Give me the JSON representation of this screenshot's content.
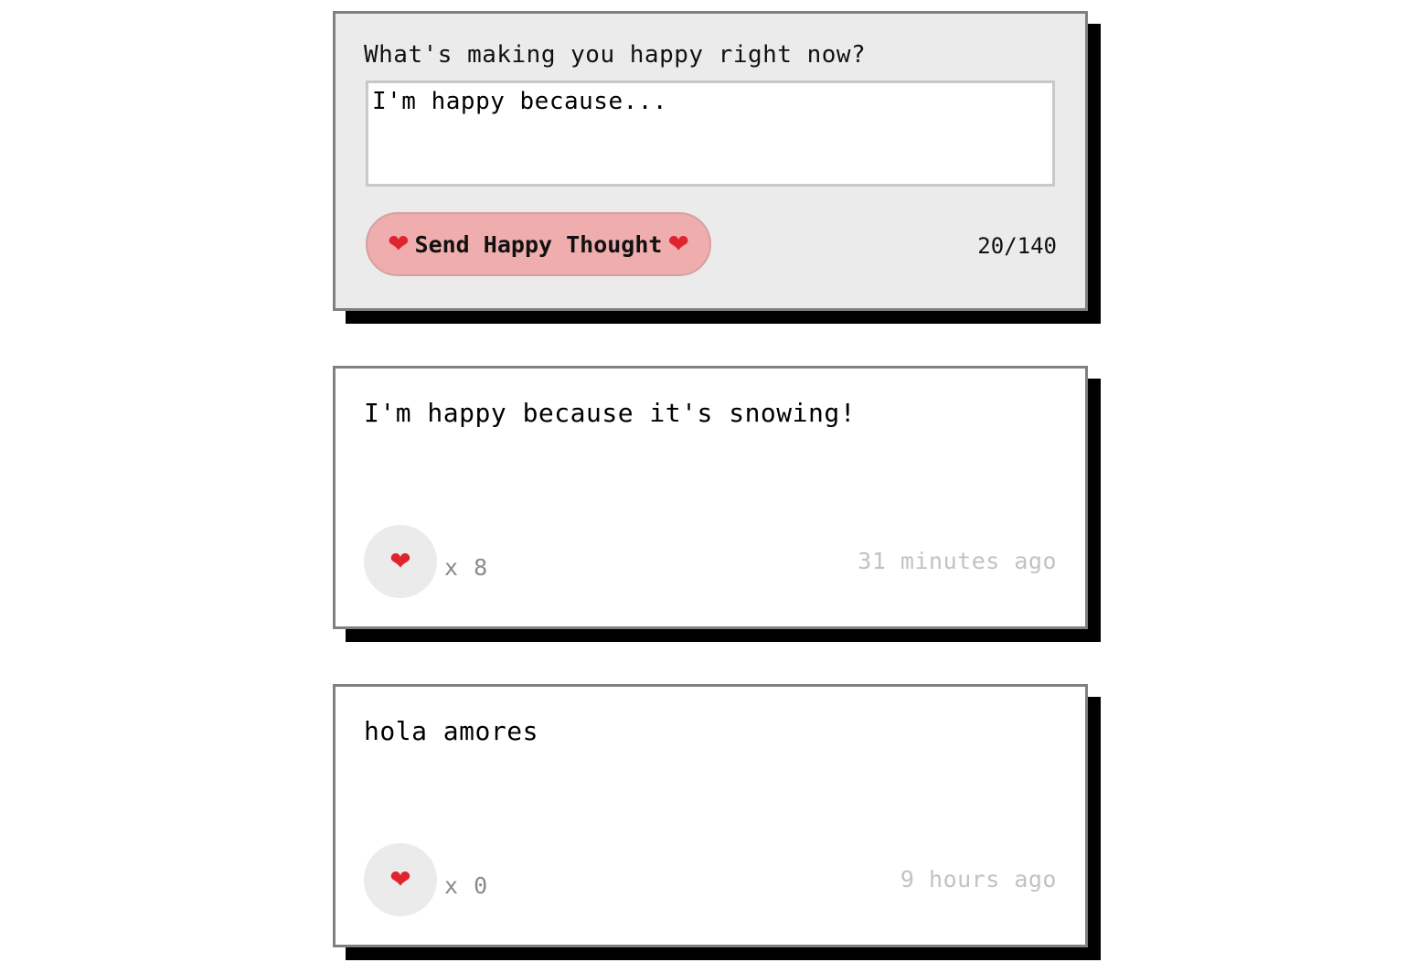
{
  "form": {
    "prompt": "What's making you happy right now?",
    "input_value": "I'm happy because...",
    "send_label": "Send Happy Thought",
    "heart_glyph": "❤",
    "char_count": "20/140"
  },
  "thoughts": [
    {
      "message": "I'm happy because it's snowing!",
      "heart_glyph": "❤",
      "likes": "x 8",
      "time_ago": "31 minutes ago"
    },
    {
      "message": "hola amores",
      "heart_glyph": "❤",
      "likes": "x 0",
      "time_ago": "9 hours ago"
    }
  ],
  "colors": {
    "form_background": "#ebebeb",
    "button_background": "#f0adae",
    "heart": "#e0242e",
    "card_border": "#808080",
    "shadow": "#000000",
    "like_bubble": "#ebebeb",
    "like_count": "#8a8a8a",
    "time_text": "#c2c2c2"
  }
}
